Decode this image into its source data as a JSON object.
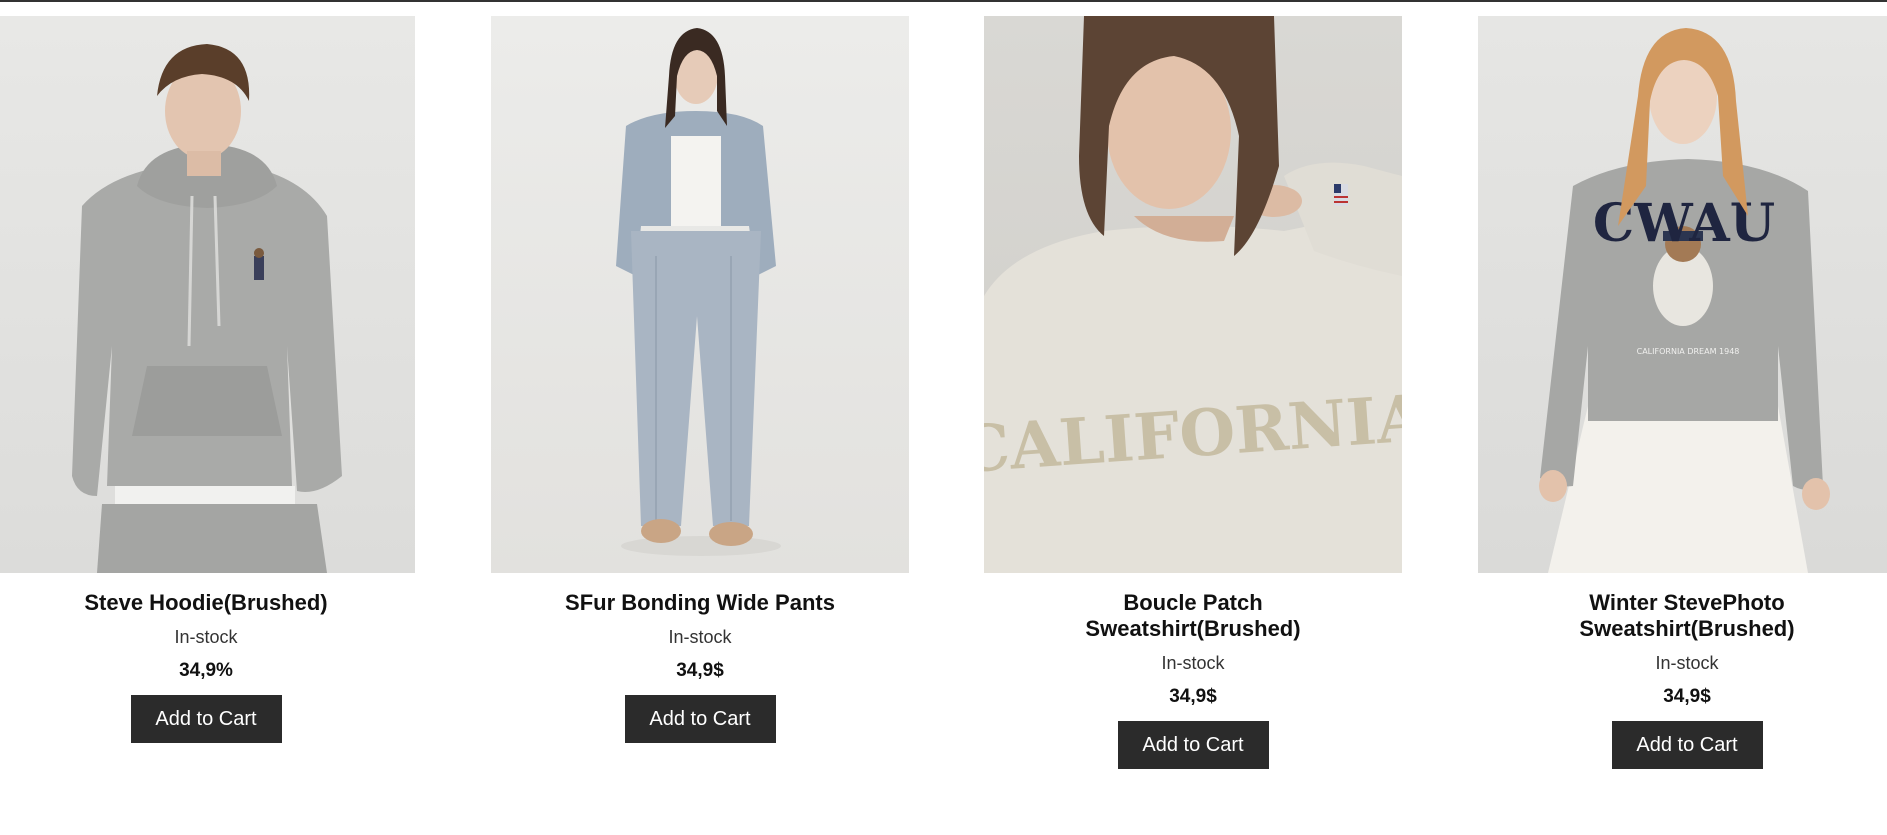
{
  "products": [
    {
      "title": "Steve Hoodie(Brushed)",
      "stock": "In-stock",
      "price": "34,9%",
      "button_label": "Add to Cart",
      "image_alt": "model wearing grey hoodie with bear emblem"
    },
    {
      "title": "SFur Bonding Wide Pants",
      "stock": "In-stock",
      "price": "34,9$",
      "button_label": "Add to Cart",
      "image_alt": "model wearing light blue zip hoodie and wide corduroy pants"
    },
    {
      "title": "Boucle Patch Sweatshirt(Brushed)",
      "stock": "In-stock",
      "price": "34,9$",
      "button_label": "Add to Cart",
      "image_alt": "model wearing oatmeal sweatshirt with CALIFORNIA patch",
      "print_text": "CALIFORNIA"
    },
    {
      "title": "Winter StevePhoto Sweatshirt(Brushed)",
      "stock": "In-stock",
      "price": "34,9$",
      "button_label": "Add to Cart",
      "image_alt": "model wearing grey sweatshirt with CWAU bear print",
      "print_text": "CWAU",
      "print_subtext": "CALIFORNIA DREAM 1948"
    }
  ]
}
